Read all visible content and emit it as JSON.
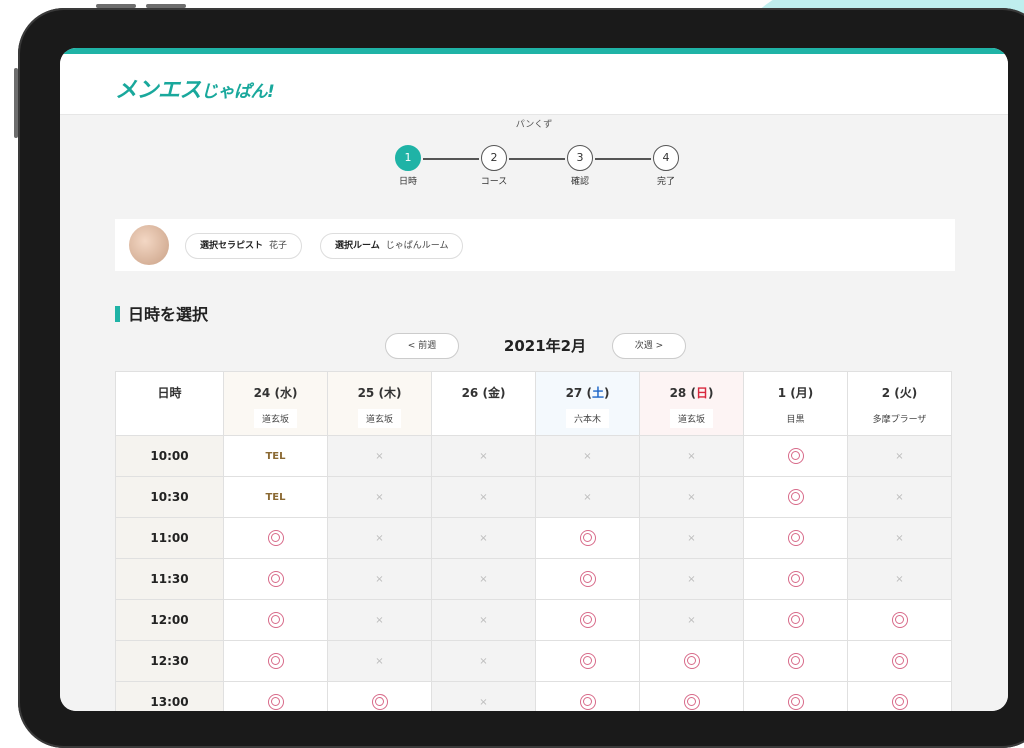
{
  "app": {
    "logo_main": "メンエス",
    "logo_sub": "じゃぱん!"
  },
  "breadcrumb": "パンくず",
  "steps": [
    {
      "num": "1",
      "label": "日時",
      "active": true
    },
    {
      "num": "2",
      "label": "コース",
      "active": false
    },
    {
      "num": "3",
      "label": "確認",
      "active": false
    },
    {
      "num": "4",
      "label": "完了",
      "active": false
    }
  ],
  "selection": {
    "therapist_label": "選択セラピスト",
    "therapist_value": "花子",
    "room_label": "選択ルーム",
    "room_value": "じゃぱんルーム"
  },
  "section_title": "日時を選択",
  "week": {
    "prev": "< 前週",
    "month": "2021年2月",
    "next": "次週 >"
  },
  "calendar": {
    "time_header": "日時",
    "days": [
      {
        "date": "24",
        "dow": "水",
        "place": "道玄坂",
        "type": "wed"
      },
      {
        "date": "25",
        "dow": "木",
        "place": "道玄坂",
        "type": "thu"
      },
      {
        "date": "26",
        "dow": "金",
        "place": "",
        "type": "fri"
      },
      {
        "date": "27",
        "dow": "土",
        "place": "六本木",
        "type": "sat"
      },
      {
        "date": "28",
        "dow": "日",
        "place": "道玄坂",
        "type": "sun"
      },
      {
        "date": "1",
        "dow": "月",
        "place": "目黒",
        "type": "mon"
      },
      {
        "date": "2",
        "dow": "火",
        "place": "多摩プラーザ",
        "type": "tue"
      }
    ],
    "rows": [
      {
        "time": "10:00",
        "slots": [
          "TEL",
          "×",
          "×",
          "×",
          "×",
          "◎",
          "×"
        ]
      },
      {
        "time": "10:30",
        "slots": [
          "TEL",
          "×",
          "×",
          "×",
          "×",
          "◎",
          "×"
        ]
      },
      {
        "time": "11:00",
        "slots": [
          "◎",
          "×",
          "×",
          "◎",
          "×",
          "◎",
          "×"
        ]
      },
      {
        "time": "11:30",
        "slots": [
          "◎",
          "×",
          "×",
          "◎",
          "×",
          "◎",
          "×"
        ]
      },
      {
        "time": "12:00",
        "slots": [
          "◎",
          "×",
          "×",
          "◎",
          "×",
          "◎",
          "◎"
        ]
      },
      {
        "time": "12:30",
        "slots": [
          "◎",
          "×",
          "×",
          "◎",
          "◎",
          "◎",
          "◎"
        ]
      },
      {
        "time": "13:00",
        "slots": [
          "◎",
          "◎",
          "×",
          "◎",
          "◎",
          "◎",
          "◎"
        ]
      }
    ]
  },
  "colors": {
    "accent": "#1fb3a6",
    "saturday": "#1d66c8",
    "sunday": "#d8283e",
    "available": "#d86b8a",
    "tel": "#8b6a34"
  }
}
